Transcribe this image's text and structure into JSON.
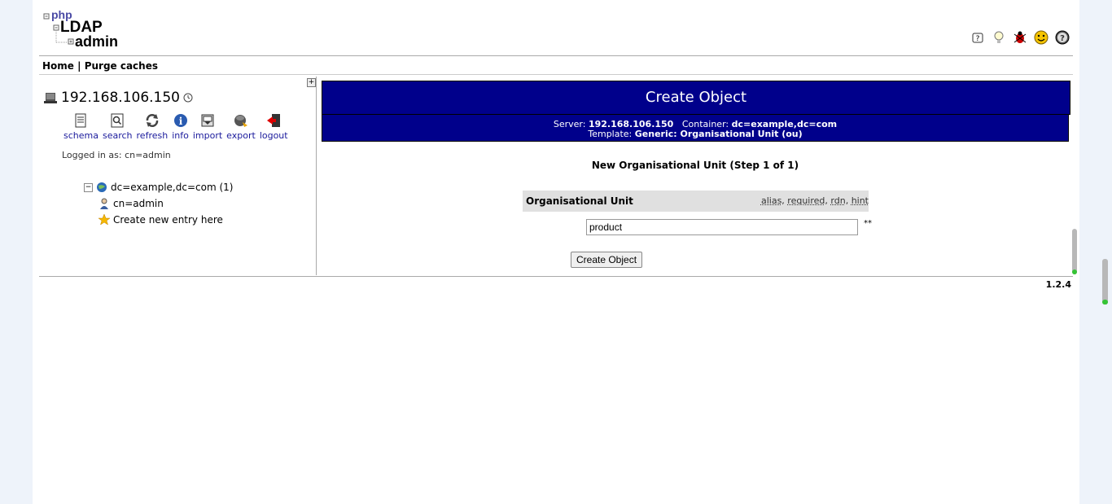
{
  "logo": {
    "line1": "php",
    "line2": "LDAP",
    "line3": "admin"
  },
  "top_icons": [
    "help-question-icon",
    "hint-bulb-icon",
    "bug-icon",
    "smiley-icon",
    "help-circle-icon"
  ],
  "menu": {
    "home": "Home",
    "separator": " | ",
    "purge": "Purge caches"
  },
  "server": {
    "host": "192.168.106.150",
    "logged_in": "Logged in as: cn=admin"
  },
  "tools": [
    {
      "label": "schema",
      "icon": "schema-icon"
    },
    {
      "label": "search",
      "icon": "search-icon"
    },
    {
      "label": "refresh",
      "icon": "refresh-icon"
    },
    {
      "label": "info",
      "icon": "info-icon"
    },
    {
      "label": "import",
      "icon": "import-icon"
    },
    {
      "label": "export",
      "icon": "export-icon"
    },
    {
      "label": "logout",
      "icon": "logout-icon"
    }
  ],
  "tree": {
    "root": "dc=example,dc=com (1)",
    "child": "cn=admin",
    "create": "Create new entry here"
  },
  "main": {
    "title": "Create Object",
    "server_label": "Server:",
    "server_value": "192.168.106.150",
    "container_label": "Container:",
    "container_value": "dc=example,dc=com",
    "template_label": "Template:",
    "template_value": "Generic: Organisational Unit (ou)",
    "step_title": "New Organisational Unit (Step 1 of 1)",
    "attr_label": "Organisational Unit",
    "hint_alias": "alias",
    "hint_required": "required",
    "hint_rdn": "rdn",
    "hint_hint": "hint",
    "ou_value": "product",
    "required_mark": "**",
    "button": "Create Object"
  },
  "version": "1.2.4"
}
